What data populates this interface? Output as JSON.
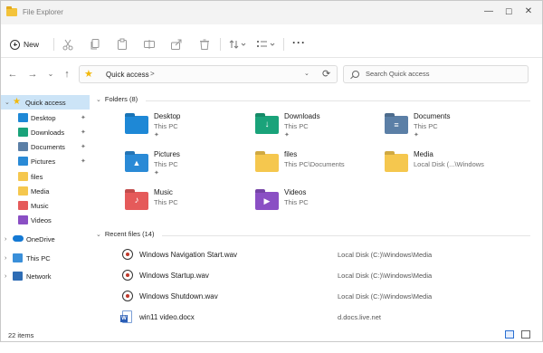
{
  "window": {
    "title": "File Explorer",
    "controls": {
      "minimize": "—",
      "maximize": "☐",
      "close": "✕"
    }
  },
  "toolbar": {
    "new_label": "New",
    "more_label": "···",
    "icons": [
      "cut-icon",
      "copy-icon",
      "paste-icon",
      "rename-icon",
      "share-icon",
      "delete-icon",
      "sort-icon",
      "view-icon"
    ]
  },
  "nav": {
    "back": "←",
    "forward": "→",
    "recent": "⌄",
    "up": "↑",
    "address": "Quick access",
    "address_chev": ">",
    "dropdown": "⌄",
    "refresh": "⟳",
    "search_placeholder": "Search Quick access"
  },
  "sidebar": {
    "items": [
      {
        "label": "Quick access",
        "icon": "star-icon",
        "pinned": false
      },
      {
        "label": "Desktop",
        "icon": "desktop-icon",
        "pinned": true
      },
      {
        "label": "Downloads",
        "icon": "downloads-icon",
        "pinned": true
      },
      {
        "label": "Documents",
        "icon": "documents-icon",
        "pinned": true
      },
      {
        "label": "Pictures",
        "icon": "pictures-icon",
        "pinned": true
      },
      {
        "label": "files",
        "icon": "folder-icon",
        "pinned": false
      },
      {
        "label": "Media",
        "icon": "folder-icon",
        "pinned": false
      },
      {
        "label": "Music",
        "icon": "music-icon",
        "pinned": false
      },
      {
        "label": "Videos",
        "icon": "videos-icon",
        "pinned": false
      },
      {
        "label": "OneDrive",
        "icon": "onedrive-icon",
        "pinned": false
      },
      {
        "label": "This PC",
        "icon": "pc-icon",
        "pinned": false
      },
      {
        "label": "Network",
        "icon": "network-icon",
        "pinned": false
      }
    ],
    "pin_glyph": "📌"
  },
  "folders": {
    "header": "Folders (8)",
    "items": [
      {
        "name": "Desktop",
        "location": "This PC",
        "pinned": true,
        "color": "#1e88d6"
      },
      {
        "name": "Downloads",
        "location": "This PC",
        "pinned": true,
        "color": "#1aa37a"
      },
      {
        "name": "Documents",
        "location": "This PC",
        "pinned": true,
        "color": "#5b7fa6"
      },
      {
        "name": "Pictures",
        "location": "This PC",
        "pinned": true,
        "color": "#2a8ad6"
      },
      {
        "name": "files",
        "location": "This PC\\Documents",
        "pinned": false,
        "color": "#f5c74e"
      },
      {
        "name": "Media",
        "location": "Local Disk (...\\Windows",
        "pinned": false,
        "color": "#f5c74e"
      },
      {
        "name": "Music",
        "location": "This PC",
        "pinned": false,
        "color": "#e55a5a"
      },
      {
        "name": "Videos",
        "location": "This PC",
        "pinned": false,
        "color": "#8a4fc4"
      }
    ]
  },
  "recent": {
    "header": "Recent files (14)",
    "items": [
      {
        "name": "Windows Navigation Start.wav",
        "location": "Local Disk (C:)\\Windows\\Media",
        "type": "audio"
      },
      {
        "name": "Windows Startup.wav",
        "location": "Local Disk (C:)\\Windows\\Media",
        "type": "audio"
      },
      {
        "name": "Windows Shutdown.wav",
        "location": "Local Disk (C:)\\Windows\\Media",
        "type": "audio"
      },
      {
        "name": "win11 video.docx",
        "location": "d.docs.live.net",
        "type": "doc"
      }
    ]
  },
  "status": {
    "item_count": "22 items"
  }
}
